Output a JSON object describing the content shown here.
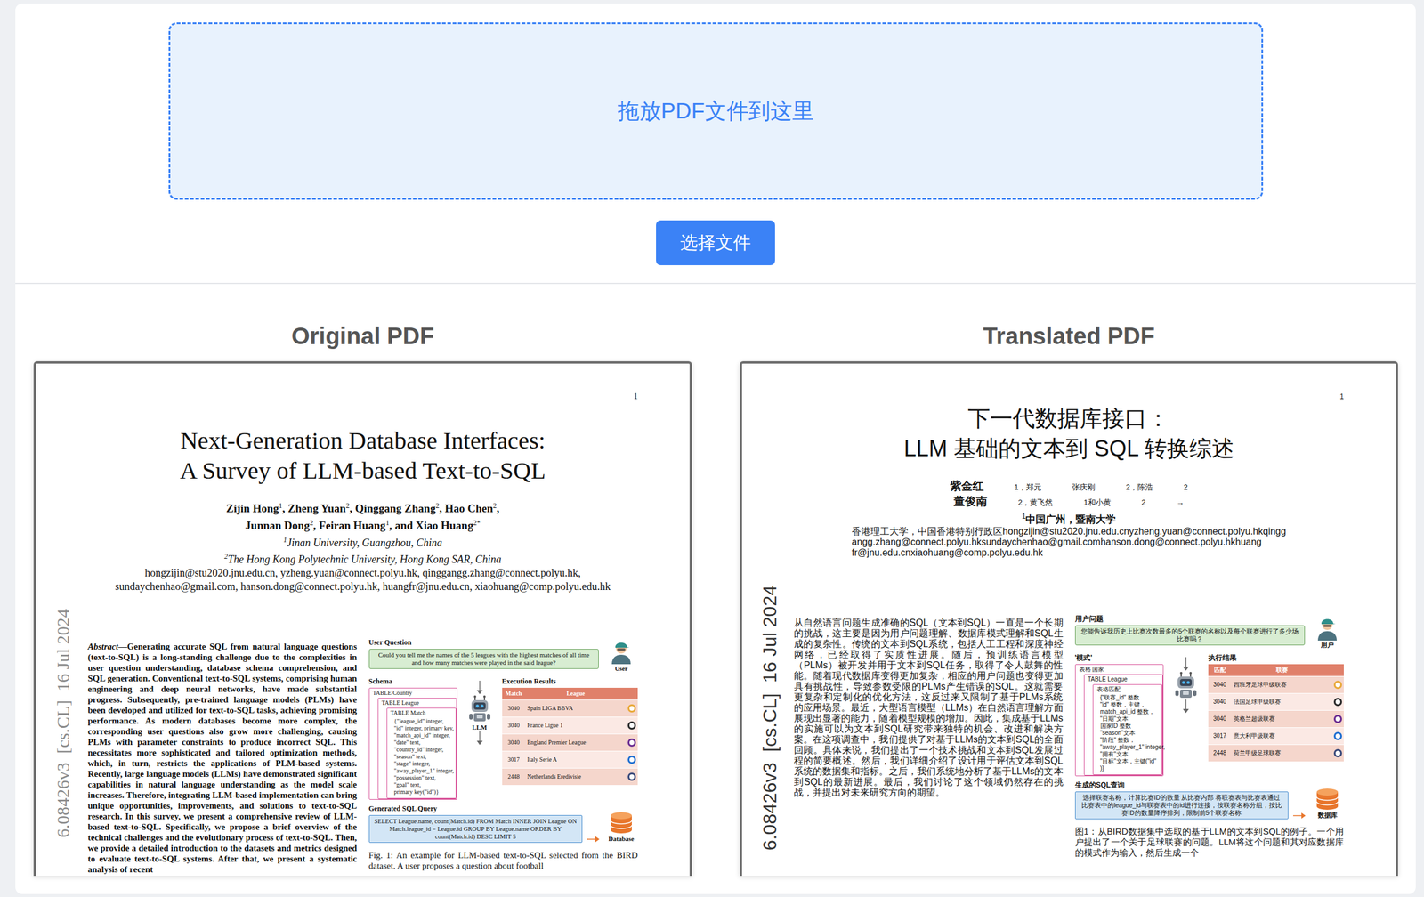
{
  "dropzone": {
    "text": "拖放PDF文件到这里"
  },
  "select_button": {
    "label": "选择文件"
  },
  "panels": [
    {
      "heading": "Original PDF",
      "page": {
        "kind": "original",
        "page_number": "1",
        "title": [
          "Next-Generation Database Interfaces:",
          "A Survey of LLM-based Text-to-SQL"
        ],
        "authors": [
          [
            {
              "text": "Zijin Hong",
              "sup": "1",
              "kind": "name"
            },
            {
              "text": ", Zheng Yuan",
              "sup": "2",
              "kind": "name"
            },
            {
              "text": ", Qinggang Zhang",
              "sup": "2",
              "kind": "name"
            },
            {
              "text": ", Hao Chen",
              "sup": "2",
              "kind": "name"
            },
            {
              "text": ",",
              "kind": "name"
            }
          ],
          [
            {
              "text": "Junnan Dong",
              "sup": "2",
              "kind": "name"
            },
            {
              "text": ", Feiran Huang",
              "sup": "1",
              "kind": "name"
            },
            {
              "text": ", and Xiao Huang",
              "sup": "2*",
              "kind": "name"
            }
          ]
        ],
        "affiliations": [
          {
            "sup": "1",
            "text": "Jinan University, Guangzhou, China"
          },
          {
            "sup": "2",
            "text": "The Hong Kong Polytechnic University, Hong Kong SAR, China"
          }
        ],
        "emails": [
          "hongzijin@stu2020.jnu.edu.cn, yzheng.yuan@connect.polyu.hk, qinggangg.zhang@connect.polyu.hk,",
          "sundaychenhao@gmail.com, hanson.dong@connect.polyu.hk, huangfr@jnu.edu.cn, xiaohuang@comp.polyu.edu.hk"
        ],
        "stamp": "6.08426v3  [cs.CL]  16 Jul 2024",
        "abstract": {
          "label": "Abstract",
          "text": "—Generating accurate SQL from natural language questions (text-to-SQL) is a long-standing challenge due to the complexities in user question understanding, database schema comprehension, and SQL generation. Conventional text-to-SQL systems, comprising human engineering and deep neural networks, have made substantial progress. Subsequently, pre-trained language models (PLMs) have been developed and utilized for text-to-SQL tasks, achieving promising performance. As modern databases become more complex, the corresponding user questions also grow more challenging, causing PLMs with parameter constraints to produce incorrect SQL. This necessitates more sophisticated and tailored optimization methods, which, in turn, restricts the applications of PLM-based systems. Recently, large language models (LLMs) have demonstrated significant capabilities in natural language understanding as the model scale increases. Therefore, integrating LLM-based implementation can bring unique opportunities, improvements, and solutions to text-to-SQL research. In this survey, we present a comprehensive review of LLM-based text-to-SQL. Specifically, we propose a brief overview of the technical challenges and the evolutionary process of text-to-SQL. Then, we provide a detailed introduction to the datasets and metrics designed to evaluate text-to-SQL systems. After that, we present a systematic analysis of recent"
        },
        "figure": {
          "question_label": "User Question",
          "question": "Could you tell me the names of the 5 leagues with the highest matches of all time and how many matches were played in the said league?",
          "user_label": "User",
          "schema_label": "Schema",
          "schema_tables": [
            "TABLE Country",
            "TABLE League",
            "TABLE Match"
          ],
          "schema_fields": [
            "{\"league_id\" integer,",
            "\"id\" integer, primary key,",
            "\"match_api_id\" integer,",
            "\"date\" text,",
            "\"country_id\" integer,",
            "\"season\" text,",
            "\"stage\" integer,",
            "\"away_player_1\" integer,",
            "\"possession\" text,",
            "\"goal\" text,",
            "primary key(\"id\")}"
          ],
          "llm_label": "LLM",
          "results_label": "Execution Results",
          "results_columns": [
            "Match",
            "League"
          ],
          "results_rows": [
            {
              "match": "3040",
              "league": "Spain LIGA BBVA",
              "color": "#e9a93a"
            },
            {
              "match": "3040",
              "league": "France Ligue 1",
              "color": "#2b2b2b"
            },
            {
              "match": "3040",
              "league": "England Premier League",
              "color": "#6a2c91"
            },
            {
              "match": "3017",
              "league": "Italy Serie A",
              "color": "#1f6fd1"
            },
            {
              "match": "2448",
              "league": "Netherlands Eredivisie",
              "color": "#3a4a7a"
            }
          ],
          "sql_label": "Generated SQL Query",
          "sql": "SELECT League.name, count(Match.id) FROM Match INNER JOIN League ON Match.league_id = League.id GROUP BY League.name ORDER BY count(Match.id) DESC LIMIT 5",
          "database_label": "Database"
        },
        "caption": "Fig. 1: An example for LLM-based text-to-SQL selected from the BIRD dataset. A user proposes a question about football"
      }
    },
    {
      "heading": "Translated PDF",
      "page": {
        "kind": "translated",
        "page_number": "1",
        "title": [
          "下一代数据库接口：",
          "LLM 基础的文本到 SQL 转换综述"
        ],
        "authors": [
          [
            {
              "text": "紫金红",
              "kind": "name"
            },
            {
              "text": "1，郑元",
              "kind": "note"
            },
            {
              "text": "张庆刚",
              "kind": "note"
            },
            {
              "text": "2，陈浩",
              "kind": "note"
            },
            {
              "text": "2",
              "kind": "note"
            }
          ],
          [
            {
              "text": "董俊南",
              "kind": "name"
            },
            {
              "text": "2，黄飞然",
              "kind": "note"
            },
            {
              "text": "1和小黄",
              "kind": "note"
            },
            {
              "text": "2",
              "kind": "note"
            },
            {
              "text": "→",
              "kind": "note"
            }
          ]
        ],
        "affiliations": [
          {
            "sup": "1",
            "text": "中国广州，暨南大学"
          }
        ],
        "emails": [
          "香港理工大学，中国香港特别行政区hongzijin@stu2020.jnu.edu.cnyzheng.yuan@connect.polyu.hkqingg",
          "angg.zhang@connect.polyu.hksundaychenhao@gmail.comhanson.dong@connect.polyu.hkhuang",
          "fr@jnu.edu.cnxiaohuang@comp.polyu.edu.hk"
        ],
        "stamp": "6.08426v3  [cs.CL]  16 Jul 2024",
        "abstract": {
          "text": "从自然语言问题生成准确的SQL（文本到SQL）一直是一个长期的挑战，这主要是因为用户问题理解、数据库模式理解和SQL生成的复杂性。传统的文本到SQL系统，包括人工工程和深度神经网络，已经取得了实质性进展。随后，预训练语言模型（PLMs）被开发并用于文本到SQL任务，取得了令人鼓舞的性能。随着现代数据库变得更加复杂，相应的用户问题也变得更加具有挑战性，导致参数受限的PLMs产生错误的SQL。这就需要更复杂和定制化的优化方法，这反过来又限制了基于PLMs系统的应用场景。最近，大型语言模型（LLMs）在自然语言理解方面展现出显著的能力，随着模型规模的增加。因此，集成基于LLMs的实施可以为文本到SQL研究带来独特的机会、改进和解决方案。在这项调查中，我们提供了对基于LLMs的文本到SQL的全面回顾。具体来说，我们提出了一个技术挑战和文本到SQL发展过程的简要概述。然后，我们详细介绍了设计用于评估文本到SQL系统的数据集和指标。之后，我们系统地分析了基于LLMs的文本到SQL的最新进展。最后，我们讨论了这个领域仍然存在的挑战，并提出对未来研究方向的期望。"
        },
        "figure": {
          "question_label": "用户问题",
          "question": "您能告诉我历史上比赛次数最多的5个联赛的名称以及每个联赛进行了多少场比赛吗？",
          "user_label": "用户",
          "schema_label": "'模式'",
          "schema_tables": [
            "表格 国家",
            "TABLE League",
            "表格匹配"
          ],
          "schema_fields": [
            "{\"联赛_id\" 整数",
            "\"id\" 整数，主键，",
            "match_api_id 整数，",
            "\"日期\"文本",
            "国家ID 整数",
            "\"season\"文本",
            "\"阶段\" 整数，",
            "\"away_player_1\" integer,",
            "\"拥有\"文本",
            "\"目标\"文本，主键(\"id\"",
            ")}"
          ],
          "results_label": "执行结果",
          "results_columns": [
            "匹配",
            "联赛"
          ],
          "results_rows": [
            {
              "match": "3040",
              "league": "西班牙足球甲级联赛",
              "color": "#e9a93a"
            },
            {
              "match": "3040",
              "league": "法国足球甲级联赛",
              "color": "#2b2b2b"
            },
            {
              "match": "3040",
              "league": "英格兰超级联赛",
              "color": "#6a2c91"
            },
            {
              "match": "3017",
              "league": "意大利甲级联赛",
              "color": "#1f6fd1"
            },
            {
              "match": "2448",
              "league": "荷兰甲级足球联赛",
              "color": "#3a4a7a"
            }
          ],
          "sql_label": "生成的SQL查询",
          "sql": "选择联赛名称，计算比赛ID的数量 从比赛内部 将联赛表与比赛表通过比赛表中的league_id与联赛表中的id进行连接，按联赛名称分组，按比赛ID的数量降序排列，限制前5个联赛名称",
          "database_label": "数据库"
        },
        "caption": "图1：从BIRD数据集中选取的基于LLM的文本到SQL的例子。一个用户提出了一个关于足球联赛的问题。LLM将这个问题和其对应数据库的模式作为输入，然后生成一个"
      }
    }
  ]
}
